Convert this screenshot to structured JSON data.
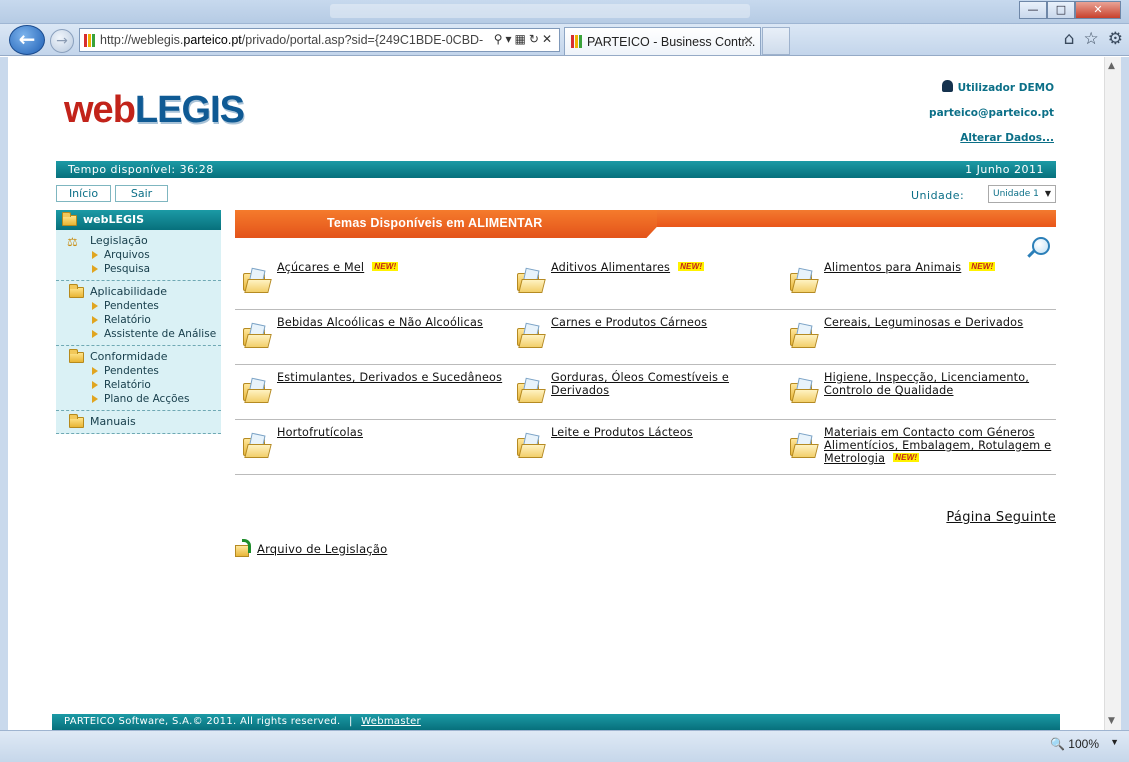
{
  "browser": {
    "address": {
      "prefix": "http://weblegis.",
      "domain": "parteico.pt",
      "path": "/privado/portal.asp?sid={249C1BDE-0CBD-"
    },
    "tab_title": "PARTEICO - Business Contr...",
    "zoom": "100%"
  },
  "header": {
    "logo_web": "web",
    "logo_legis": "LEGIS",
    "user_name": "Utilizador DEMO",
    "user_email": "parteico@parteico.pt",
    "alter_link": "Alterar Dados..."
  },
  "topbar": {
    "time_left": "Tempo disponível: 36:28",
    "date": "1 Junho 2011"
  },
  "nav": {
    "inicio": "Início",
    "sair": "Sair",
    "unidade_label": "Unidade:",
    "unidade_value": "Unidade 1"
  },
  "sidebar": {
    "title": "webLEGIS",
    "sections": [
      {
        "title": "Legislação",
        "items": [
          "Arquivos",
          "Pesquisa"
        ]
      },
      {
        "title": "Aplicabilidade",
        "items": [
          "Pendentes",
          "Relatório",
          "Assistente de Análise"
        ]
      },
      {
        "title": "Conformidade",
        "items": [
          "Pendentes",
          "Relatório",
          "Plano de Acções"
        ]
      },
      {
        "title": "Manuais",
        "items": []
      }
    ]
  },
  "main": {
    "title": "Temas Disponíveis em ALIMENTAR",
    "new_badge": "NEW!",
    "themes": [
      {
        "l1": "Açúcares e Mel",
        "l2": "",
        "l3": ""
      },
      {
        "l1": "Aditivos Alimentares",
        "l2": "",
        "l3": ""
      },
      {
        "l1": "Alimentos para Animais",
        "l2": "",
        "l3": ""
      },
      {
        "l1": "Bebidas Alcoólicas e Não Alcoólicas",
        "l2": "",
        "l3": ""
      },
      {
        "l1": "Carnes e Produtos Cárneos",
        "l2": "",
        "l3": ""
      },
      {
        "l1": "Cereais, Leguminosas e Derivados",
        "l2": "",
        "l3": ""
      },
      {
        "l1": "Estimulantes, Derivados e Sucedâneos",
        "l2": "",
        "l3": ""
      },
      {
        "l1": "Gorduras, Óleos Comestíveis e",
        "l2": "Derivados",
        "l3": ""
      },
      {
        "l1": "Higiene, Inspecção, Licenciamento,",
        "l2": "Controlo de Qualidade",
        "l3": ""
      },
      {
        "l1": "Hortofrutícolas",
        "l2": "",
        "l3": ""
      },
      {
        "l1": "Leite e Produtos Lácteos",
        "l2": "",
        "l3": ""
      },
      {
        "l1": "Materiais em Contacto com Géneros",
        "l2": "Alimentícios, Embalagem, Rotulagem e",
        "l3": "Metrologia"
      }
    ],
    "next_page": "Página Seguinte",
    "arquivo": "Arquivo de Legislação"
  },
  "footer": {
    "copyright": "PARTEICO Software, S.A.© 2011. All rights reserved.",
    "separator": "|",
    "webmaster": "Webmaster"
  }
}
